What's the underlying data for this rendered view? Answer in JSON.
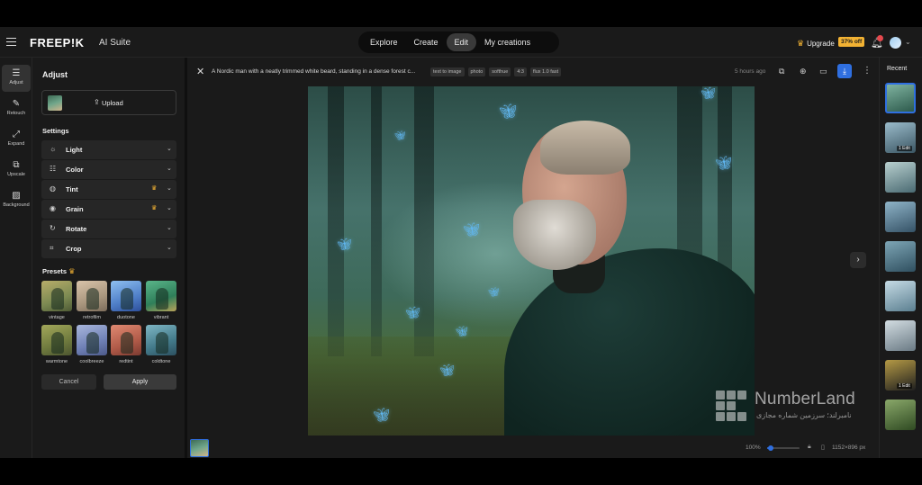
{
  "header": {
    "logo": "FREEP!K",
    "suite": "AI Suite",
    "nav": [
      {
        "label": "Explore"
      },
      {
        "label": "Create"
      },
      {
        "label": "Edit",
        "active": true
      },
      {
        "label": "My creations"
      }
    ],
    "upgrade_label": "Upgrade",
    "discount_badge": "37% off",
    "accent_color": "#2f6fe0",
    "crown_color": "#f2b233"
  },
  "rail": [
    {
      "label": "Adjust",
      "icon": "sliders-icon",
      "active": true
    },
    {
      "label": "Retouch",
      "icon": "bandage-icon"
    },
    {
      "label": "Expand",
      "icon": "expand-icon"
    },
    {
      "label": "Upscale",
      "icon": "upscale-icon"
    },
    {
      "label": "Background",
      "icon": "background-icon"
    }
  ],
  "panel": {
    "title": "Adjust",
    "upload_label": "Upload",
    "settings_title": "Settings",
    "settings": [
      {
        "label": "Light",
        "icon": "sun-icon",
        "premium": false
      },
      {
        "label": "Color",
        "icon": "sliders-icon",
        "premium": false
      },
      {
        "label": "Tint",
        "icon": "palette-icon",
        "premium": true
      },
      {
        "label": "Grain",
        "icon": "grain-icon",
        "premium": true
      },
      {
        "label": "Rotate",
        "icon": "rotate-icon",
        "premium": false
      },
      {
        "label": "Crop",
        "icon": "crop-icon",
        "premium": false
      }
    ],
    "presets_title": "Presets",
    "presets": [
      {
        "label": "vintage",
        "tint": "#9c9a63"
      },
      {
        "label": "retrofilm",
        "tint": "#b9a58f"
      },
      {
        "label": "duotone",
        "tint": "#5f8ec9"
      },
      {
        "label": "vibrant",
        "tint": "#3f8f66"
      },
      {
        "label": "warmtone",
        "tint": "#8c8f4f"
      },
      {
        "label": "coolbreeze",
        "tint": "#7a8fb8"
      },
      {
        "label": "redtint",
        "tint": "#c06a5a"
      },
      {
        "label": "coldtone",
        "tint": "#4f8a9a"
      }
    ],
    "cancel_label": "Cancel",
    "apply_label": "Apply"
  },
  "canvas": {
    "prompt": "A Nordic man with a neatly trimmed white beard, standing in a dense forest c...",
    "tags": [
      "text to image",
      "photo",
      "softhue",
      "4:3",
      "flux 1.0 fast"
    ],
    "time": "5 hours ago",
    "zoom": "100%",
    "zoom_fraction": 0.1,
    "dimensions": "1152×896 px"
  },
  "recent": {
    "title": "Recent",
    "items": [
      {
        "colors": [
          "#2d5a4c",
          "#7fb3a0"
        ],
        "active": true,
        "badge": ""
      },
      {
        "colors": [
          "#3b5663",
          "#9bbccb"
        ],
        "badge": "1 Edit"
      },
      {
        "colors": [
          "#4a6a72",
          "#b9d0cf"
        ],
        "badge": ""
      },
      {
        "colors": [
          "#355266",
          "#8fb4c8"
        ],
        "badge": ""
      },
      {
        "colors": [
          "#2f4f5f",
          "#7ea6b6"
        ],
        "badge": ""
      },
      {
        "colors": [
          "#5b7f90",
          "#c6dbe5"
        ],
        "badge": ""
      },
      {
        "colors": [
          "#6a7a84",
          "#d3dde2"
        ],
        "badge": ""
      },
      {
        "colors": [
          "#1f1f1f",
          "#b59a45"
        ],
        "badge": "1 Edit"
      },
      {
        "colors": [
          "#2f4a22",
          "#8aa86a"
        ],
        "badge": ""
      },
      {
        "colors": [
          "#3d5e3a",
          "#a4c07a"
        ],
        "badge": ""
      }
    ]
  },
  "watermark": {
    "title": "NumberLand",
    "subtitle": "نامبرلند؛ سرزمین شماره مجازی"
  }
}
